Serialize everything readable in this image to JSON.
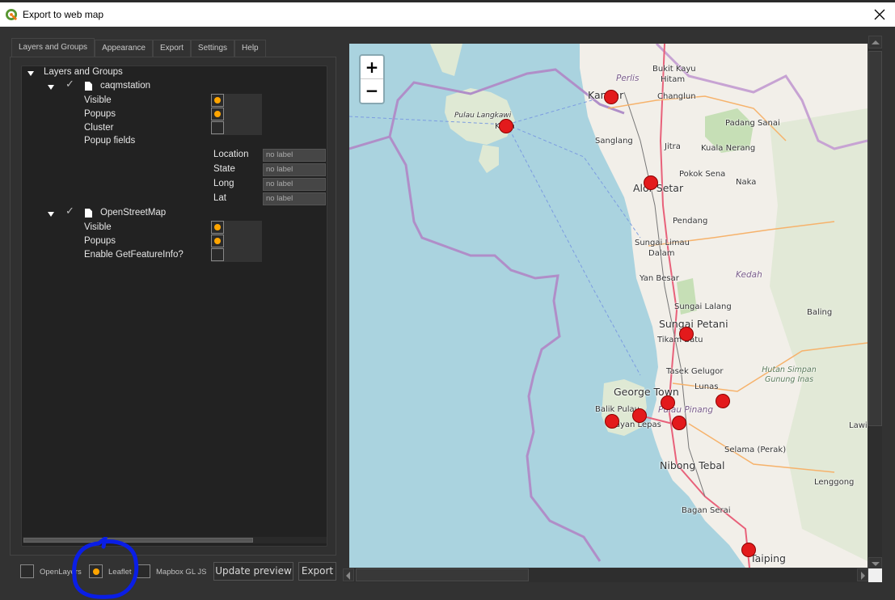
{
  "window": {
    "title": "Export to web map",
    "app_icon": "qgis-logo-icon",
    "close_icon": "close-icon"
  },
  "tabs": [
    {
      "label": "Layers and Groups",
      "active": true
    },
    {
      "label": "Appearance",
      "active": false
    },
    {
      "label": "Export",
      "active": false
    },
    {
      "label": "Settings",
      "active": false
    },
    {
      "label": "Help",
      "active": false
    }
  ],
  "tree": {
    "root_label": "Layers and Groups",
    "layers": [
      {
        "name": "caqmstation",
        "checked": true,
        "options": [
          {
            "label": "Visible",
            "checked": true
          },
          {
            "label": "Popups",
            "checked": true
          },
          {
            "label": "Cluster",
            "checked": false
          }
        ],
        "popup_fields_label": "Popup fields",
        "popup_fields": [
          {
            "name": "Location",
            "value": "no label"
          },
          {
            "name": "State",
            "value": "no label"
          },
          {
            "name": "Long",
            "value": "no label"
          },
          {
            "name": "Lat",
            "value": "no label"
          }
        ]
      },
      {
        "name": "OpenStreetMap",
        "checked": true,
        "options": [
          {
            "label": "Visible",
            "checked": true
          },
          {
            "label": "Popups",
            "checked": true
          },
          {
            "label": "Enable GetFeatureInfo?",
            "checked": false
          }
        ]
      }
    ]
  },
  "bottom": {
    "formats": [
      {
        "label": "OpenLayers",
        "selected": false
      },
      {
        "label": "Leaflet",
        "selected": true
      },
      {
        "label": "Mapbox GL JS",
        "selected": false
      }
    ],
    "update_preview_label": "Update preview",
    "export_label": "Export"
  },
  "map": {
    "zoom_in_label": "+",
    "zoom_out_label": "−",
    "places": [
      {
        "name": "Bukit Kayu",
        "cls": ""
      },
      {
        "name": "Hitam",
        "cls": ""
      },
      {
        "name": "Perlis",
        "cls": "italic"
      },
      {
        "name": "Kangar",
        "cls": "big"
      },
      {
        "name": "Changlun",
        "cls": ""
      },
      {
        "name": "Padang Sanai",
        "cls": ""
      },
      {
        "name": "Pulau Langkawi",
        "cls": "langkawi"
      },
      {
        "name": "Kuah",
        "cls": ""
      },
      {
        "name": "Sanglang",
        "cls": ""
      },
      {
        "name": "Jitra",
        "cls": ""
      },
      {
        "name": "Kuala Nerang",
        "cls": ""
      },
      {
        "name": "Pokok Sena",
        "cls": ""
      },
      {
        "name": "Alor Setar",
        "cls": "big"
      },
      {
        "name": "Naka",
        "cls": ""
      },
      {
        "name": "Pendang",
        "cls": ""
      },
      {
        "name": "Sungai Limau",
        "cls": ""
      },
      {
        "name": "Dalam",
        "cls": ""
      },
      {
        "name": "Kedah",
        "cls": "italic"
      },
      {
        "name": "Yan Besar",
        "cls": ""
      },
      {
        "name": "Sungai Lalang",
        "cls": ""
      },
      {
        "name": "Baling",
        "cls": ""
      },
      {
        "name": "Sungai Petani",
        "cls": "big"
      },
      {
        "name": "Tikam Batu",
        "cls": ""
      },
      {
        "name": "Tasek Gelugor",
        "cls": ""
      },
      {
        "name": "Hutan Simpan Gunung Inas",
        "cls": "forest"
      },
      {
        "name": "George Town",
        "cls": "big"
      },
      {
        "name": "Lunas",
        "cls": ""
      },
      {
        "name": "Balik Pulau",
        "cls": ""
      },
      {
        "name": "Pulau Pinang",
        "cls": "italic"
      },
      {
        "name": "Bayan Lepas",
        "cls": ""
      },
      {
        "name": "Lawin",
        "cls": ""
      },
      {
        "name": "Selama (Perak)",
        "cls": ""
      },
      {
        "name": "Nibong Tebal",
        "cls": "big"
      },
      {
        "name": "Lenggong",
        "cls": ""
      },
      {
        "name": "Bagan Serai",
        "cls": ""
      },
      {
        "name": "Taiping",
        "cls": "big"
      }
    ],
    "markers": [
      {
        "name": "Kangar station"
      },
      {
        "name": "Langkawi station"
      },
      {
        "name": "Alor Setar station"
      },
      {
        "name": "Sungai Petani station"
      },
      {
        "name": "George Town station"
      },
      {
        "name": "Lunas station"
      },
      {
        "name": "Balik Pulau station"
      },
      {
        "name": "Penang bridge station"
      },
      {
        "name": "Prai station"
      },
      {
        "name": "Taiping station"
      }
    ],
    "colors": {
      "water": "#aad3df",
      "land": "#f2efe9",
      "forest": "#cfe3c6",
      "boundary": "#b08ec8",
      "marker": "#e31a1c",
      "selection_accent": "#ffa500"
    }
  }
}
